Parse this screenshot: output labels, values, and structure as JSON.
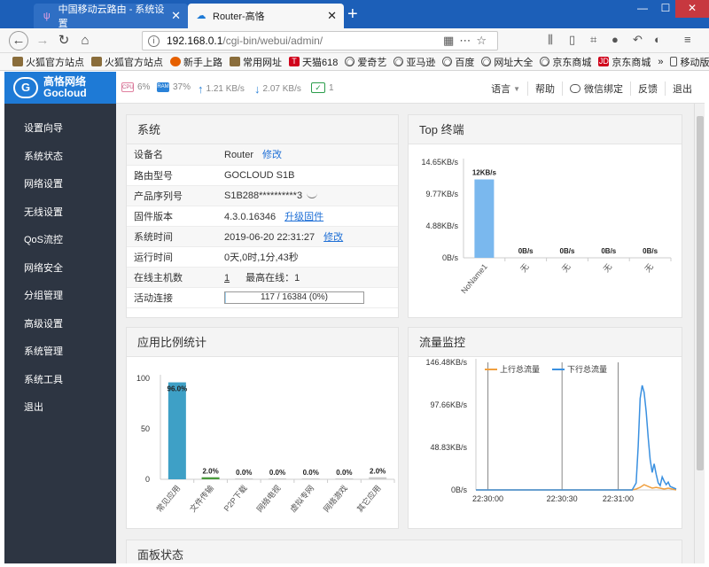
{
  "browser": {
    "tabs": [
      {
        "label": "中国移动云路由 - 系统设置",
        "active": false
      },
      {
        "label": "Router-高恪",
        "active": true
      }
    ],
    "new_tab": "+",
    "window_controls": {
      "minimize": "—",
      "maximize": "☐",
      "close": "✕"
    },
    "url": {
      "host": "192.168.0.1",
      "path": "/cgi-bin/webui/admin/"
    },
    "bookmarks": [
      "火狐官方站点",
      "火狐官方站点",
      "新手上路",
      "常用网址",
      "天猫618",
      "爱奇艺",
      "亚马逊",
      "百度",
      "网址大全",
      "京东商城",
      "京东商城",
      "移动版书签"
    ],
    "bookmark_overflow": "»"
  },
  "header": {
    "logo_cn": "高恪网络",
    "logo_en": "Gocloud",
    "stats": {
      "cpu_label": "CPU",
      "cpu": "6%",
      "ram_label": "RAM",
      "ram": "37%",
      "up": "1.21 KB/s",
      "down": "2.07 KB/s",
      "online": "1"
    },
    "links": [
      "语言",
      "帮助",
      "微信绑定",
      "反馈",
      "退出"
    ]
  },
  "sidebar": {
    "items": [
      "设置向导",
      "系统状态",
      "网络设置",
      "无线设置",
      "QoS流控",
      "网络安全",
      "分组管理",
      "高级设置",
      "系统管理",
      "系统工具",
      "退出"
    ]
  },
  "system": {
    "title": "系统",
    "rows": [
      {
        "label": "设备名",
        "value": "Router",
        "link": "修改"
      },
      {
        "label": "路由型号",
        "value": "GOCLOUD S1B",
        "link": ""
      },
      {
        "label": "产品序列号",
        "value": "S1B288**********3",
        "link": ""
      },
      {
        "label": "固件版本",
        "value": "4.3.0.16346",
        "link": "升级固件"
      },
      {
        "label": "系统时间",
        "value": "2019-06-20 22:31:27",
        "link": "修改"
      },
      {
        "label": "运行时间",
        "value": "0天,0时,1分,43秒",
        "link": ""
      },
      {
        "label": "在线主机数",
        "value": "1",
        "extra": "最高在线：1",
        "link": ""
      },
      {
        "label": "活动连接",
        "value": "117 / 16384 (0%)",
        "progress": 0.0071,
        "link": ""
      }
    ]
  },
  "top_terminals": {
    "title": "Top 终端",
    "chart_data": {
      "type": "bar",
      "categories": [
        "NoName1",
        "无",
        "无",
        "无",
        "无"
      ],
      "values": [
        12,
        0,
        0,
        0,
        0
      ],
      "labels": [
        "12KB/s",
        "0B/s",
        "0B/s",
        "0B/s",
        "0B/s"
      ],
      "yticks": [
        "14.65KB/s",
        "9.77KB/s",
        "4.88KB/s",
        "0B/s"
      ],
      "ytick_values": [
        14.65,
        9.77,
        4.88,
        0
      ],
      "ylim": [
        0,
        14.65
      ],
      "color": "#7ab8ee"
    }
  },
  "app_ratio": {
    "title": "应用比例统计",
    "chart_data": {
      "type": "bar",
      "categories": [
        "常见应用",
        "文件传输",
        "P2P下载",
        "网络电视",
        "虚拟专网",
        "网络游戏",
        "其它应用"
      ],
      "values": [
        96.0,
        2.0,
        0.0,
        0.0,
        0.0,
        0.0,
        2.0
      ],
      "labels": [
        "96.0%",
        "2.0%",
        "0.0%",
        "0.0%",
        "0.0%",
        "0.0%",
        "2.0%"
      ],
      "yticks": [
        100,
        50,
        0
      ],
      "ylim": [
        0,
        100
      ],
      "colors": [
        "#3ea0c6",
        "#4a9a3c",
        "#cccccc",
        "#cccccc",
        "#cccccc",
        "#cccccc",
        "#cccccc"
      ]
    }
  },
  "traffic": {
    "title": "流量监控",
    "chart_data": {
      "type": "line",
      "yticks": [
        "146.48KB/s",
        "97.66KB/s",
        "48.83KB/s",
        "0B/s"
      ],
      "ytick_values": [
        146.48,
        97.66,
        48.83,
        0
      ],
      "ylim": [
        0,
        146.48
      ],
      "xticks": [
        "22:30:00",
        "22:30:30",
        "22:31:00"
      ],
      "series": [
        {
          "name": "上行总流量",
          "color": "#f0a040",
          "x": [
            0,
            0.78,
            0.8,
            0.82,
            0.84,
            0.86,
            0.88,
            0.9,
            0.92,
            0.94,
            0.96,
            0.98,
            1.0
          ],
          "values": [
            0,
            0,
            1,
            3,
            6,
            4,
            2,
            3,
            2,
            1,
            2,
            1,
            0
          ]
        },
        {
          "name": "下行总流量",
          "color": "#3a90e0",
          "x": [
            0,
            0.78,
            0.8,
            0.81,
            0.82,
            0.83,
            0.84,
            0.85,
            0.86,
            0.87,
            0.88,
            0.89,
            0.9,
            0.91,
            0.92,
            0.93,
            0.94,
            0.95,
            0.96,
            0.97,
            0.98,
            1.0
          ],
          "values": [
            0,
            0,
            8,
            50,
            105,
            120,
            112,
            90,
            60,
            35,
            20,
            30,
            18,
            8,
            5,
            15,
            10,
            6,
            9,
            4,
            3,
            1
          ]
        }
      ]
    }
  },
  "panel_status": {
    "title": "面板状态"
  }
}
